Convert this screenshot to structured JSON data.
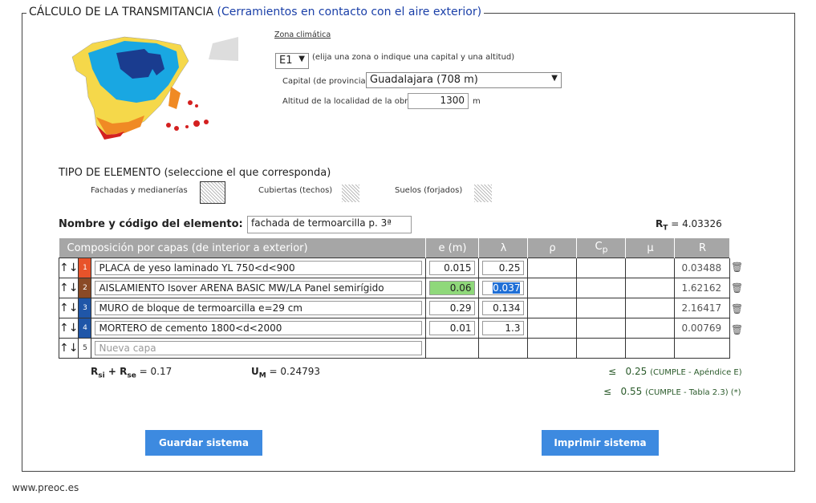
{
  "header": {
    "title": "CÁLCULO DE LA TRANSMITANCIA",
    "subtitle": "(Cerramientos en contacto con el aire exterior)"
  },
  "zona": {
    "link": "Zona climática",
    "value": "E1",
    "hint": "(elija una zona o indique una capital y una altitud)",
    "capital_label": "Capital (de provincia)",
    "capital_value": "Guadalajara (708 m)",
    "altitud_label": "Altitud de la localidad de la obra",
    "altitud_value": "1300",
    "altitud_unit": "m"
  },
  "tipo": {
    "title": "TIPO DE ELEMENTO (seleccione el que corresponda)",
    "options": [
      "Fachadas y medianerías",
      "Cubiertas (techos)",
      "Suelos (forjados)"
    ]
  },
  "element": {
    "label": "Nombre y código del elemento:",
    "value": "fachada de termoarcilla p. 3ª",
    "rt_label": "R",
    "rt_sub": "T",
    "rt_value": "= 4.03326"
  },
  "table": {
    "headers": [
      "Composición por capas (de interior a exterior)",
      "e (m)",
      "λ",
      "ρ",
      "C",
      "μ",
      "R"
    ],
    "cp_sub": "p",
    "arrows": "↑↓",
    "rows": [
      {
        "num": "1",
        "color": "#e8532a",
        "name": "PLACA de yeso laminado YL 750<d<900",
        "e": "0.015",
        "lambda": "0.25",
        "R": "0.03488"
      },
      {
        "num": "2",
        "color": "#8a4a26",
        "name": "AISLAMIENTO Isover ARENA BASIC MW/LA Panel  semirígido",
        "e": "0.06",
        "lambda": "0.037",
        "R": "1.62162"
      },
      {
        "num": "3",
        "color": "#1f56a8",
        "name": "MURO de bloque de termoarcilla e=29 cm",
        "e": "0.29",
        "lambda": "0.134",
        "R": "2.16417"
      },
      {
        "num": "4",
        "color": "#1f56a8",
        "name": "MORTERO de cemento 1800<d<2000",
        "e": "0.01",
        "lambda": "1.3",
        "R": "0.00769"
      }
    ],
    "new_row": {
      "num": "5",
      "placeholder": "Nueva capa"
    }
  },
  "footer": {
    "rsi": "R",
    "rsi_sub": "si",
    "plus": " + R",
    "rse_sub": "se",
    "rsum": " = 0.17",
    "um": "U",
    "um_sub": "M",
    "um_value": " = 0.24793",
    "check1_sym": "≤",
    "check1_value": "0.25",
    "check1_note": "(CUMPLE - Apéndice E)",
    "check2_sym": "≤",
    "check2_value": "0.55",
    "check2_note": "(CUMPLE - Tabla 2.3) (*)"
  },
  "buttons": {
    "save": "Guardar sistema",
    "print": "Imprimir sistema"
  },
  "site": "www.preoc.es",
  "colors": {
    "accent": "#3d8ae0",
    "header": "#a6a6a6",
    "highlight_green": "#8fd87a",
    "selected_blue": "#1f6fd6"
  }
}
